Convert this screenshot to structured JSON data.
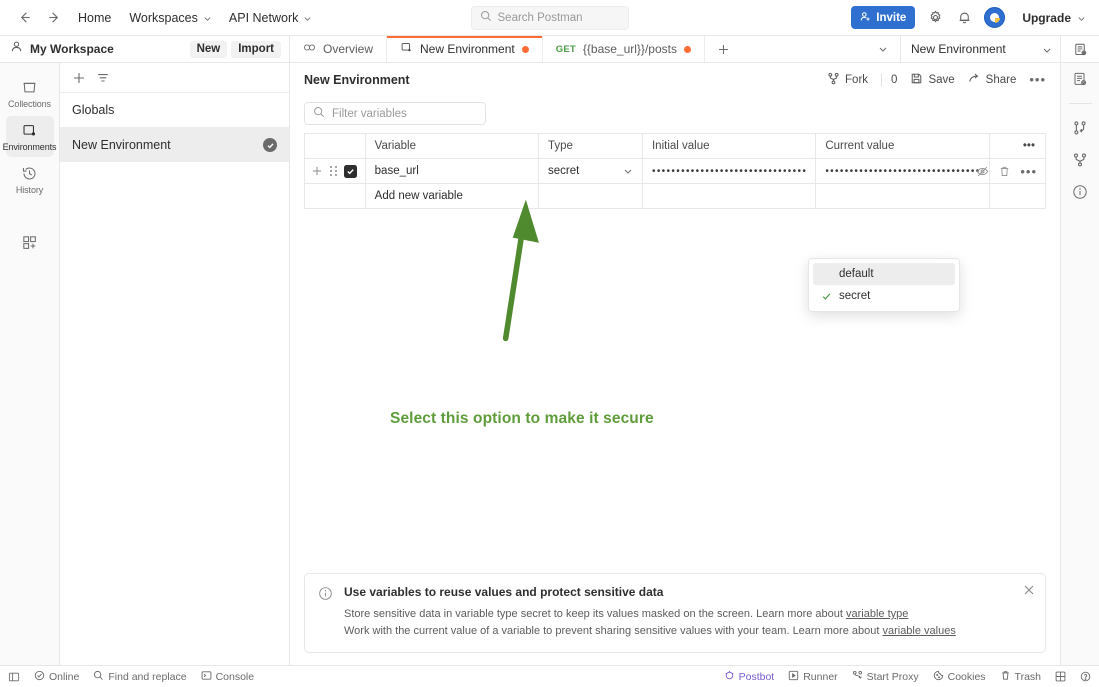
{
  "topbar": {
    "back_icon": "arrow-left-icon",
    "forward_icon": "arrow-right-icon",
    "nav": [
      {
        "label": "Home",
        "caret": false
      },
      {
        "label": "Workspaces",
        "caret": true
      },
      {
        "label": "API Network",
        "caret": true
      }
    ],
    "search": {
      "placeholder": "Search Postman",
      "icon": "search-icon"
    },
    "invite_label": "Invite",
    "invite_color": "#2f6fd0",
    "settings_icon": "gear-icon",
    "notifications_icon": "bell-icon",
    "avatar_icon": "user-avatar",
    "upgrade_label": "Upgrade"
  },
  "workspace": {
    "title": "My Workspace",
    "user_icon": "person-icon",
    "new_label": "New",
    "import_label": "Import"
  },
  "tabs": {
    "items": [
      {
        "label": "Overview",
        "icon": "overview-icon",
        "active": false,
        "unsaved": false,
        "method": ""
      },
      {
        "label": "New Environment",
        "icon": "environment-icon",
        "active": true,
        "unsaved": true,
        "method": ""
      },
      {
        "label": "{{base_url}}/posts",
        "icon": "",
        "active": false,
        "unsaved": true,
        "method": "GET"
      }
    ],
    "add_tab_icon": "plus-icon",
    "overflow_icon": "chevron-down-icon",
    "env_selector": "New Environment",
    "env_quick_look_icon": "environment-quick-look-icon"
  },
  "sidebar": {
    "items": [
      {
        "label": "Collections",
        "icon": "collections-icon",
        "active": false
      },
      {
        "label": "Environments",
        "icon": "environments-icon",
        "active": true
      },
      {
        "label": "History",
        "icon": "history-icon",
        "active": false
      }
    ],
    "apps_icon": "grid-plus-icon"
  },
  "env_pane": {
    "add_icon": "plus-icon",
    "filter_icon": "filter-icon",
    "globals_label": "Globals",
    "environments": [
      {
        "label": "New Environment",
        "selected": true,
        "active_check": true
      }
    ]
  },
  "main": {
    "title": "New Environment",
    "fork_label": "Fork",
    "fork_count": "0",
    "save_label": "Save",
    "share_label": "Share",
    "more_icon": "ellipsis-icon",
    "fork_icon": "fork-icon",
    "save_icon": "save-icon",
    "share_icon": "share-icon",
    "filter_placeholder": "Filter variables",
    "filter_icon": "search-icon"
  },
  "table": {
    "columns": [
      "Variable",
      "Type",
      "Initial value",
      "Current value"
    ],
    "column_options_icon": "ellipsis-icon",
    "rows": [
      {
        "enabled": true,
        "variable": "base_url",
        "type": "secret",
        "initial_value": "••••••••••••••••••••••••••••••••",
        "current_value": "••••••••••••••••••••••••••••••••••",
        "actions": [
          "eye-off-icon",
          "trash-icon",
          "ellipsis-icon"
        ]
      }
    ],
    "add_row_placeholder": "Add new variable",
    "add_icon": "plus-icon",
    "drag_icon": "drag-handle-icon"
  },
  "type_dropdown": {
    "options": [
      {
        "label": "default",
        "selected": false,
        "hovered": true
      },
      {
        "label": "secret",
        "selected": true,
        "hovered": false
      }
    ],
    "check_icon": "check-icon"
  },
  "annotation": {
    "text": "Select this option to make it secure",
    "color": "#5f9c3a",
    "arrow_icon": "arrow-up-annotation"
  },
  "banner": {
    "info_icon": "info-icon",
    "close_icon": "close-icon",
    "title": "Use variables to reuse values and protect sensitive data",
    "line1_prefix": "Store sensitive data in variable type secret to keep its values masked on the screen. Learn more about ",
    "line1_link": "variable type",
    "line2_prefix": "Work with the current value of a variable to prevent sharing sensitive values with your team. Learn more about ",
    "line2_link": "variable values"
  },
  "right_rail": {
    "items": [
      {
        "icon": "environment-quick-look-icon"
      },
      {
        "icon": "pull-request-icon"
      },
      {
        "icon": "fork-icon"
      },
      {
        "icon": "info-icon"
      }
    ]
  },
  "bottombar": {
    "sidebar_toggle_icon": "panel-toggle-icon",
    "left": [
      {
        "label": "Online",
        "icon": "status-online-icon"
      },
      {
        "label": "Find and replace",
        "icon": "search-icon"
      },
      {
        "label": "Console",
        "icon": "console-icon"
      }
    ],
    "right": [
      {
        "label": "Postbot",
        "icon": "postbot-icon"
      },
      {
        "label": "Runner",
        "icon": "runner-icon"
      },
      {
        "label": "Start Proxy",
        "icon": "proxy-icon"
      },
      {
        "label": "Cookies",
        "icon": "cookies-icon"
      },
      {
        "label": "Trash",
        "icon": "trash-icon"
      }
    ],
    "layout_icon": "layout-icon",
    "help_icon": "help-icon"
  }
}
